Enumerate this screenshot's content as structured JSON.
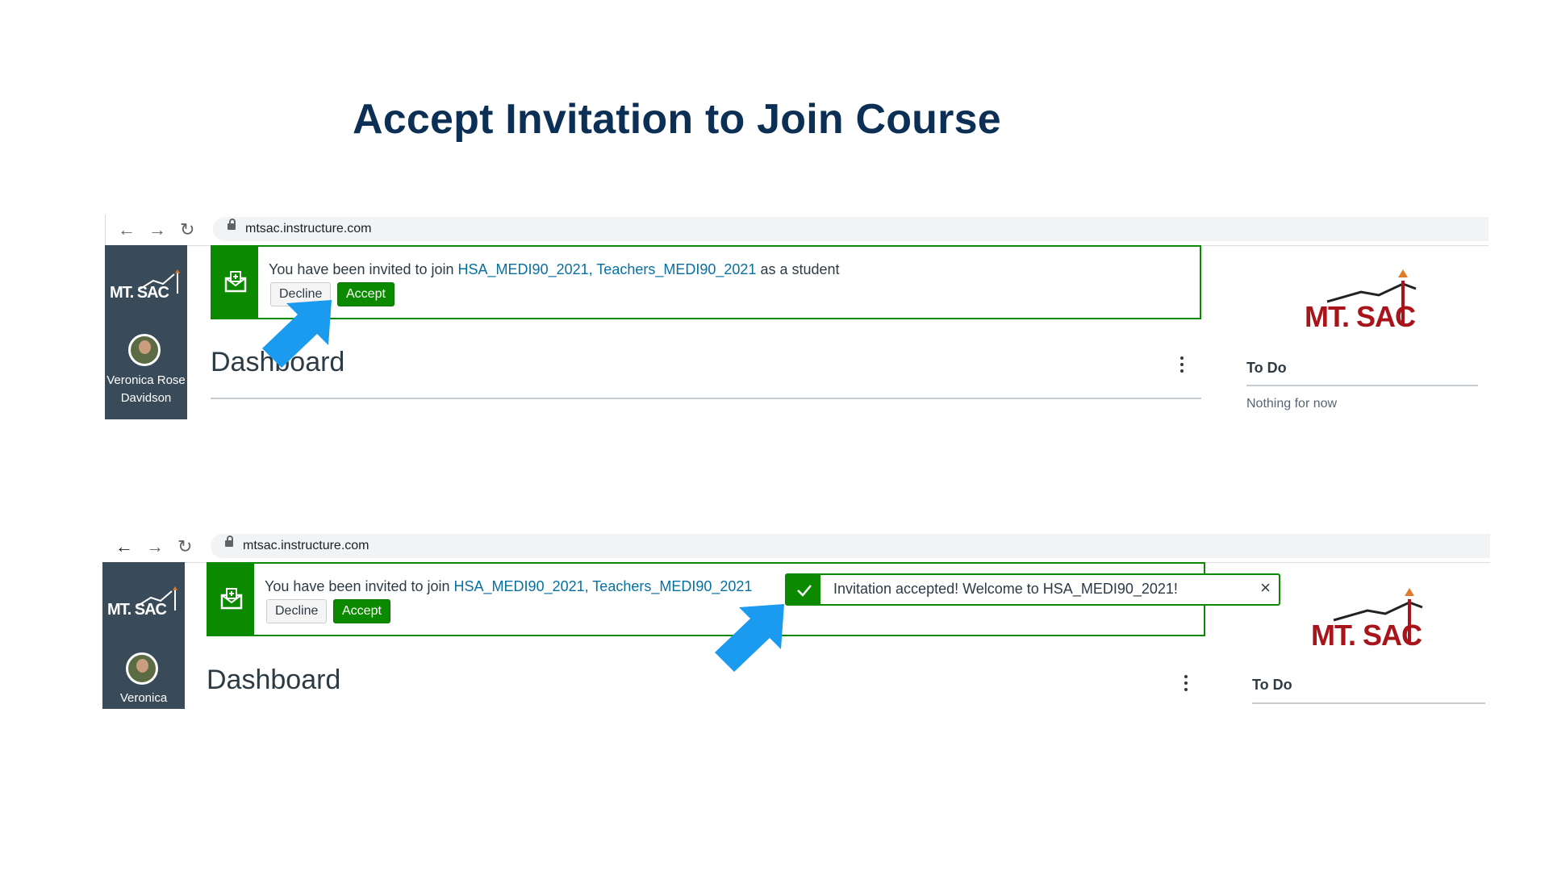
{
  "slide": {
    "title": "Accept Invitation to Join Course"
  },
  "screenshots": [
    {
      "url": "mtsac.instructure.com",
      "sidebar": {
        "logo": "MT. SAC",
        "user_name": "Veronica Rose Davidson"
      },
      "invitation": {
        "prefix": "You have been invited to join ",
        "courses": "HSA_MEDI90_2021, Teachers_MEDI90_2021",
        "suffix": " as a student",
        "decline_label": "Decline",
        "accept_label": "Accept"
      },
      "dashboard_title": "Dashboard",
      "brand_logo": "MT. SAC",
      "todo": {
        "title": "To Do",
        "empty": "Nothing for now"
      }
    },
    {
      "url": "mtsac.instructure.com",
      "sidebar": {
        "logo": "MT. SAC",
        "user_name": "Veronica"
      },
      "invitation": {
        "prefix": "You have been invited to join ",
        "courses": "HSA_MEDI90_2021, Teachers_MEDI90_2021",
        "decline_label": "Decline",
        "accept_label": "Accept"
      },
      "toast": {
        "message": "Invitation accepted! Welcome to HSA_MEDI90_2021!",
        "close_icon": "×"
      },
      "dashboard_title": "Dashboard",
      "brand_logo": "MT. SAC",
      "todo": {
        "title": "To Do"
      }
    }
  ],
  "colors": {
    "accent_green": "#0b8a00",
    "link_blue": "#0770a3",
    "title_navy": "#0c3055",
    "sidebar": "#394b58",
    "pointer_blue": "#1a9bf0",
    "brand_red": "#a8141a"
  }
}
